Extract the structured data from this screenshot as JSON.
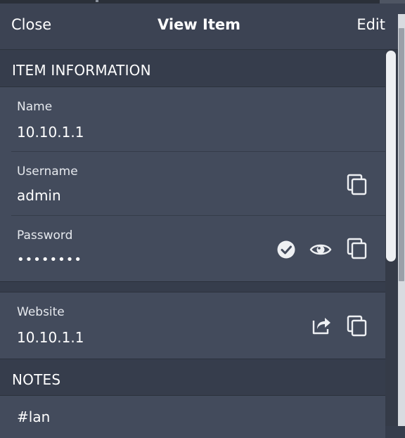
{
  "header": {
    "close_label": "Close",
    "title": "View Item",
    "edit_label": "Edit"
  },
  "sections": {
    "item_information": "ITEM INFORMATION",
    "notes": "NOTES"
  },
  "fields": {
    "name": {
      "label": "Name",
      "value": "10.10.1.1"
    },
    "username": {
      "label": "Username",
      "value": "admin"
    },
    "password": {
      "label": "Password",
      "value": "••••••••"
    },
    "website": {
      "label": "Website",
      "value": "10.10.1.1"
    }
  },
  "notes": {
    "text": "#lan"
  },
  "icons": {
    "copy": "copy-icon",
    "check": "check-circle-icon",
    "eye": "eye-icon",
    "share": "share-icon"
  },
  "colors": {
    "background": "#363d4c",
    "row": "#434b5c",
    "header": "#3c4353",
    "accent": "#3b5fa5"
  }
}
